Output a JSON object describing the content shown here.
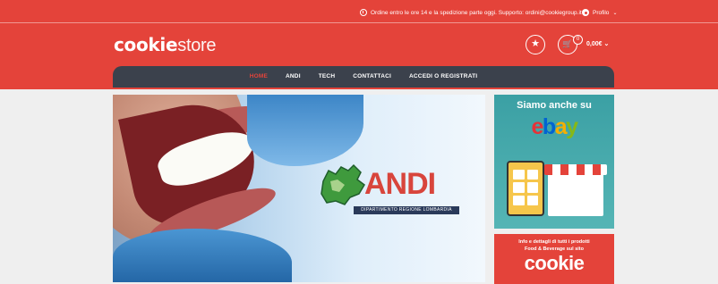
{
  "topbar": {
    "notice": "Ordine entro le ore 14 e la spedizione parte oggi. Supporto: ordini@cookiegroup.it",
    "profile_label": "Profilo"
  },
  "brand": {
    "logo_bold": "cookie",
    "logo_light": "store"
  },
  "cart": {
    "count": "0",
    "total": "0,00€"
  },
  "nav": {
    "items": [
      "HOME",
      "ANDI",
      "TECH",
      "CONTATTACI",
      "ACCEDI O REGISTRATI"
    ],
    "active": "HOME"
  },
  "hero": {
    "andi_logo": "ANDI",
    "andi_subtitle": "DIPARTIMENTO REGIONE LOMBARDIA"
  },
  "ebay_banner": {
    "title": "Siamo anche su",
    "logo": "ebay"
  },
  "cookie_banner": {
    "line1": "Info e dettagli di tutti i prodotti",
    "line2": "Food & Beverage sul sito",
    "logo": "cookie"
  },
  "colors": {
    "brand_red": "#e4433a",
    "nav_dark": "#3b414c",
    "ebay_red": "#e53238",
    "ebay_blue": "#0064d2",
    "ebay_yellow": "#f5af02",
    "ebay_green": "#86b817"
  }
}
